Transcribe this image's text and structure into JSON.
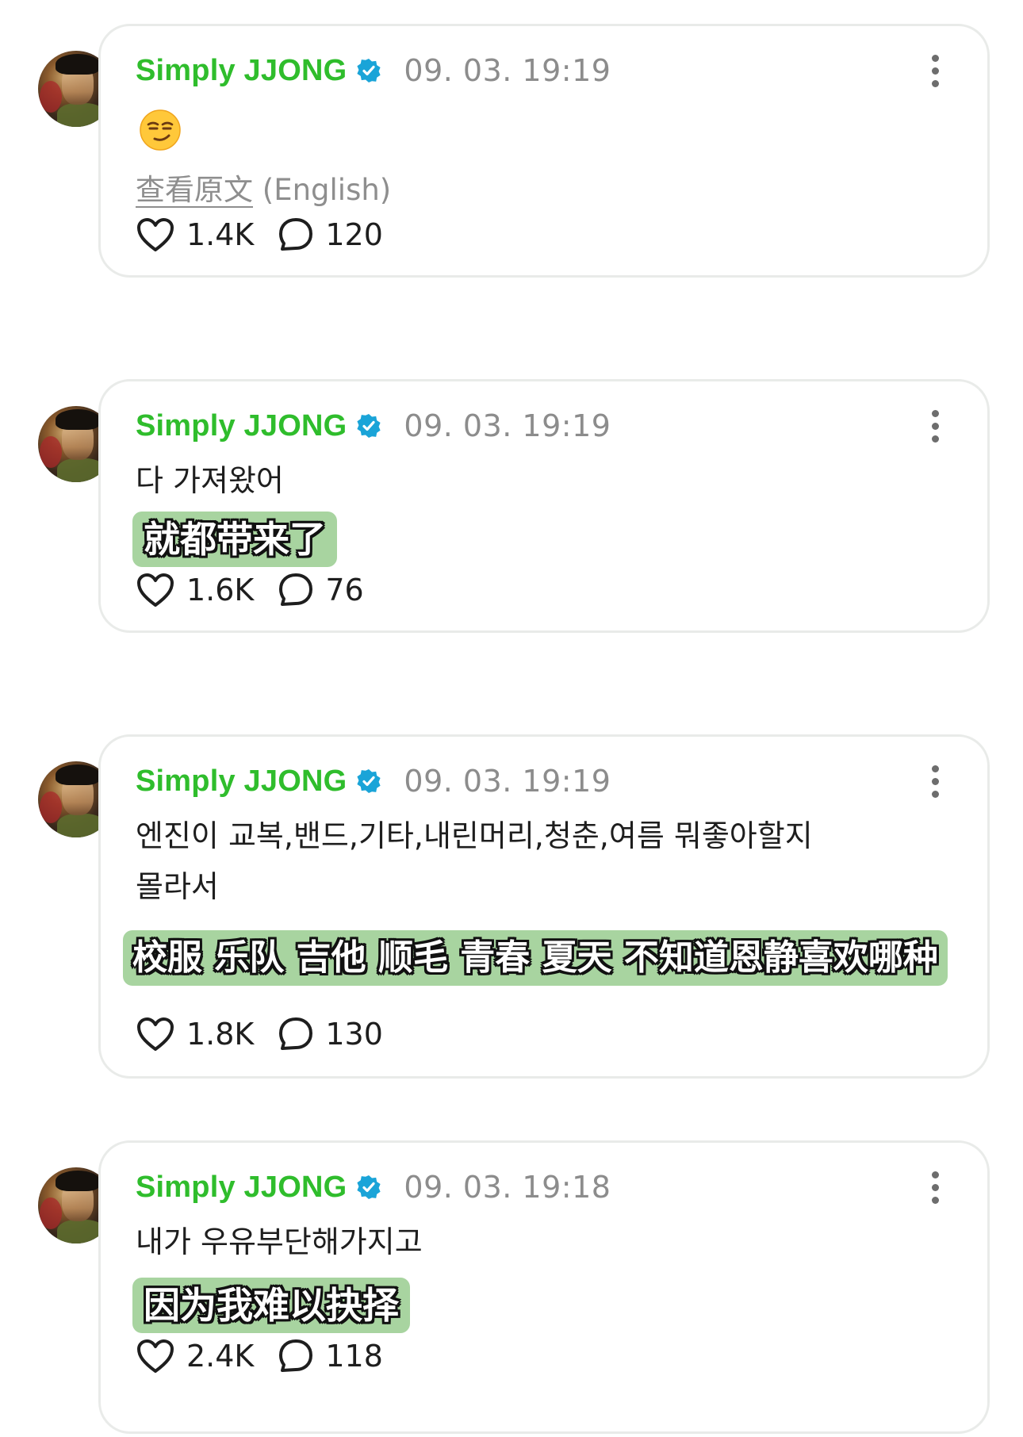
{
  "colors": {
    "name": "#2fbd2c",
    "verified": "#1aa4d8",
    "subtitle_bg": "#a8d4a0",
    "border": "#e9ebe9"
  },
  "posts": [
    {
      "author": "Simply JJONG",
      "verified_icon": "verified-badge-icon",
      "time": "09. 03. 19:19",
      "emoji": "smirking-face-emoji",
      "translate_link": "查看原文",
      "translate_lang": "(English)",
      "likes": "1.4K",
      "replies": "120"
    },
    {
      "author": "Simply JJONG",
      "time": "09. 03. 19:19",
      "text": "다 가져왔어",
      "subtitle": "就都带来了",
      "likes": "1.6K",
      "replies": "76"
    },
    {
      "author": "Simply JJONG",
      "time": "09. 03. 19:19",
      "text_line1": "엔진이 교복,밴드,기타,내린머리,청춘,여름 뭐좋아할지",
      "text_line2": "몰라서",
      "subtitle": "校服 乐队 吉他 顺毛 青春 夏天 不知道恩静喜欢哪种",
      "likes": "1.8K",
      "replies": "130"
    },
    {
      "author": "Simply JJONG",
      "time": "09. 03. 19:18",
      "text": "내가 우유부단해가지고",
      "subtitle": "因为我难以抉择",
      "likes": "2.4K",
      "replies": "118"
    }
  ]
}
